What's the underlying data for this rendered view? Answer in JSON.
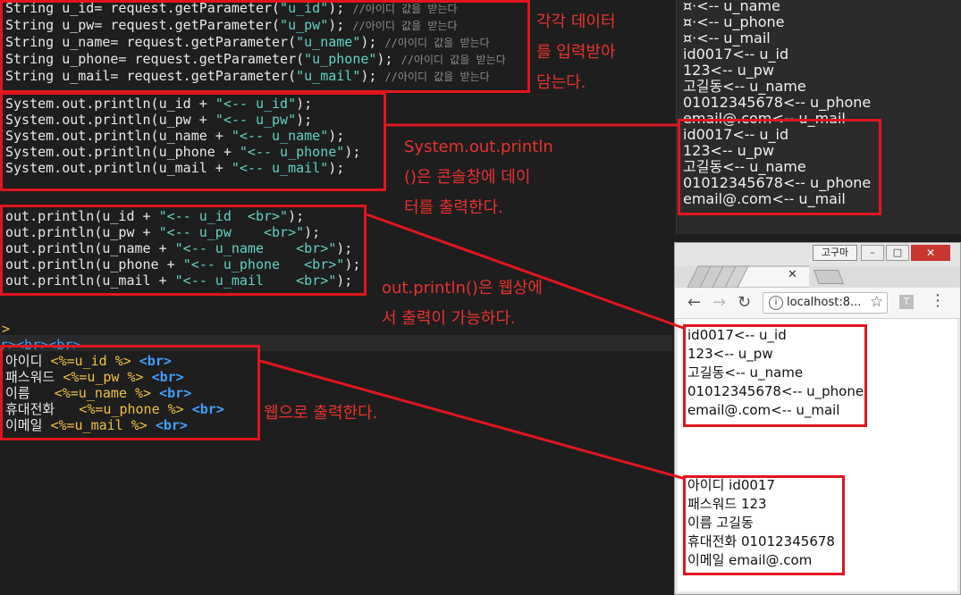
{
  "editor": {
    "block1": [
      {
        "pre": "String u_id= request.getParameter(",
        "str": "\"u_id\"",
        "post": "); ",
        "cmt": "//아이디 값을 받는다"
      },
      {
        "pre": "String u_pw= request.getParameter(",
        "str": "\"u_pw\"",
        "post": "); ",
        "cmt": "//아이디 값을 받는다"
      },
      {
        "pre": "String u_name= request.getParameter(",
        "str": "\"u_name\"",
        "post": "); ",
        "cmt": "//아이디 값을 받는다"
      },
      {
        "pre": "String u_phone= request.getParameter(",
        "str": "\"u_phone\"",
        "post": "); ",
        "cmt": "//아이디 값을 받는다"
      },
      {
        "pre": "String u_mail= request.getParameter(",
        "str": "\"u_mail\"",
        "post": "); ",
        "cmt": "//아이디 값을 받는다"
      }
    ],
    "block2": [
      {
        "pre": "System.out.println(u_id + ",
        "str": "\"<-- u_id\"",
        "post": ");"
      },
      {
        "pre": "System.out.println(u_pw + ",
        "str": "\"<-- u_pw\"",
        "post": ");"
      },
      {
        "pre": "System.out.println(u_name + ",
        "str": "\"<-- u_name\"",
        "post": ");"
      },
      {
        "pre": "System.out.println(u_phone + ",
        "str": "\"<-- u_phone\"",
        "post": ");"
      },
      {
        "pre": "System.out.println(u_mail + ",
        "str": "\"<-- u_mail\"",
        "post": ");"
      }
    ],
    "block3": [
      {
        "pre": "out.println(u_id + ",
        "str": "\"<-- u_id  <br>\"",
        "post": ");"
      },
      {
        "pre": "out.println(u_pw + ",
        "str": "\"<-- u_pw    <br>\"",
        "post": ");"
      },
      {
        "pre": "out.println(u_name + ",
        "str": "\"<-- u_name    <br>\"",
        "post": ");"
      },
      {
        "pre": "out.println(u_phone + ",
        "str": "\"<-- u_phone   <br>\"",
        "post": ");"
      },
      {
        "pre": "out.println(u_mail + ",
        "str": "\"<-- u_mail    <br>\"",
        "post": ");"
      }
    ],
    "stray1": ">",
    "stray2": "r><br><br>",
    "block4": [
      {
        "label": "아이디 ",
        "expr": "<%=u_id %>",
        "tag": "<br>"
      },
      {
        "label": "패스워드 ",
        "expr": "<%=u_pw %>",
        "tag": "<br>"
      },
      {
        "label": "이름   ",
        "expr": "<%=u_name %>",
        "tag": "<br>"
      },
      {
        "label": "휴대전화   ",
        "expr": "<%=u_phone %>",
        "tag": "<br>"
      },
      {
        "label": "이메일 ",
        "expr": "<%=u_mail %>",
        "tag": "<br>"
      }
    ]
  },
  "notes": {
    "note1": "각각 데이터\n를 입력받아\n담는다.",
    "note2": "System.out.println\n()은 콘솔창에 데이\n터를 출력한다.",
    "note3": "out.println()은 웹상에\n서 출력이 가능하다.",
    "note4": "웹으로 출력한다."
  },
  "console": {
    "lines_top": [
      "¤·<-- u_name",
      "¤·<-- u_phone",
      "¤·<-- u_mail",
      "id0017<-- u_id",
      "123<-- u_pw",
      "고길동<-- u_name",
      "01012345678<-- u_phone",
      "email@.com<-- u_mail"
    ],
    "lines_boxed": [
      "id0017<-- u_id",
      "123<-- u_pw",
      "고길동<-- u_name",
      "01012345678<-- u_phone",
      "email@.com<-- u_mail"
    ]
  },
  "browser": {
    "profile_label": "고구마",
    "url": "localhost:8...",
    "out_lines": [
      "id0017<-- u_id",
      "123<-- u_pw",
      "고길동<-- u_name",
      "01012345678<-- u_phone",
      "email@.com<-- u_mail"
    ],
    "web_lines": [
      "아이디 id0017",
      "패스워드 123",
      "이름 고길동",
      "휴대전화 01012345678",
      "이메일 email@.com"
    ]
  },
  "colors": {
    "annotation_red": "#e0161e",
    "editor_bg": "#1e1e1e",
    "string": "#5fd4c4",
    "tag": "#3ea0ff",
    "jsp": "#f0c040"
  }
}
